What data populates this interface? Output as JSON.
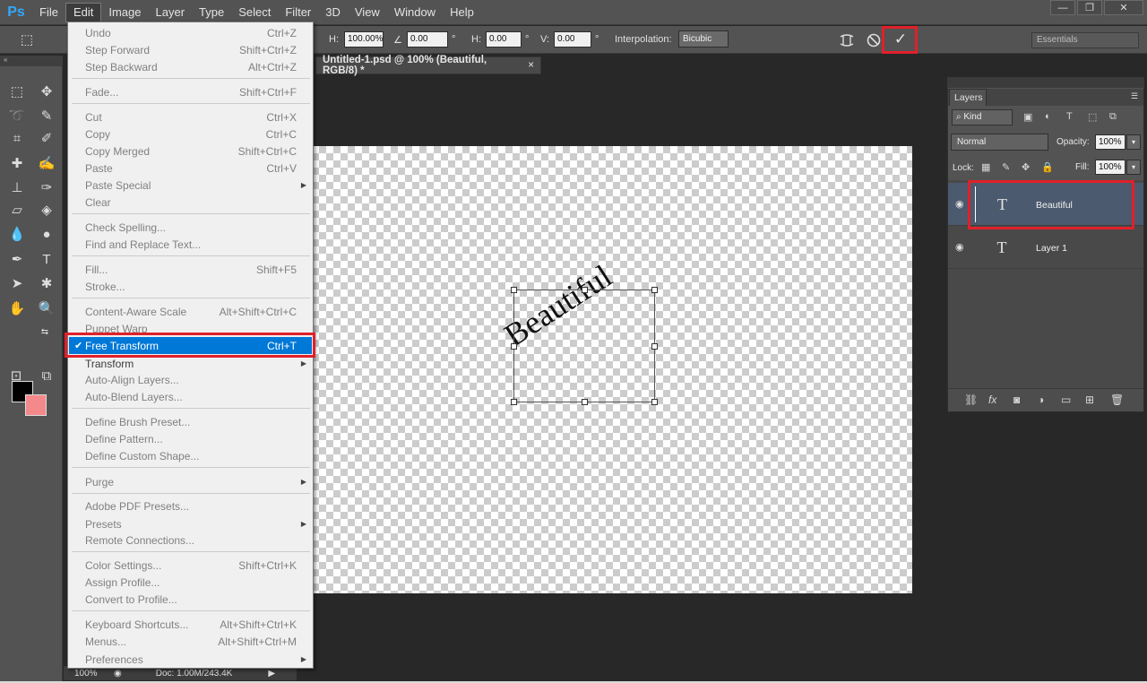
{
  "app": {
    "logo": "Ps"
  },
  "menubar": {
    "items": [
      "File",
      "Edit",
      "Image",
      "Layer",
      "Type",
      "Select",
      "Filter",
      "3D",
      "View",
      "Window",
      "Help"
    ]
  },
  "window_controls": {
    "minimize": "—",
    "restore": "❐",
    "close": "✕"
  },
  "options_bar": {
    "h_label": "H:",
    "h_value": "100.00%",
    "angle_value": "0.00",
    "angle_unit": "°",
    "hskew_label": "H:",
    "hskew_value": "0.00",
    "hskew_unit": "°",
    "vskew_label": "V:",
    "vskew_value": "0.00",
    "vskew_unit": "°",
    "interpolation_label": "Interpolation:",
    "interpolation_value": "Bicubic",
    "commit_symbol": "✓",
    "workspace": "Essentials"
  },
  "document": {
    "tab_title": "Untitled-1.psd @ 100% (Beautiful, RGB/8) *",
    "tab_close": "×",
    "canvas_text": "Beautiful"
  },
  "statusbar": {
    "zoom": "100%",
    "doc_info": "Doc: 1.00M/243.4K"
  },
  "edit_menu": {
    "items": [
      {
        "label": "Undo",
        "shortcut": "Ctrl+Z"
      },
      {
        "label": "Step Forward",
        "shortcut": "Shift+Ctrl+Z"
      },
      {
        "label": "Step Backward",
        "shortcut": "Alt+Ctrl+Z"
      },
      {
        "label": "Fade...",
        "shortcut": "Shift+Ctrl+F"
      },
      {
        "label": "Cut",
        "shortcut": "Ctrl+X"
      },
      {
        "label": "Copy",
        "shortcut": "Ctrl+C"
      },
      {
        "label": "Copy Merged",
        "shortcut": "Shift+Ctrl+C"
      },
      {
        "label": "Paste",
        "shortcut": "Ctrl+V"
      },
      {
        "label": "Paste Special",
        "shortcut": ""
      },
      {
        "label": "Clear",
        "shortcut": ""
      },
      {
        "label": "Check Spelling...",
        "shortcut": ""
      },
      {
        "label": "Find and Replace Text...",
        "shortcut": ""
      },
      {
        "label": "Fill...",
        "shortcut": "Shift+F5"
      },
      {
        "label": "Stroke...",
        "shortcut": ""
      },
      {
        "label": "Content-Aware Scale",
        "shortcut": "Alt+Shift+Ctrl+C"
      },
      {
        "label": "Puppet Warp",
        "shortcut": ""
      },
      {
        "label": "Free Transform",
        "shortcut": "Ctrl+T"
      },
      {
        "label": "Transform",
        "shortcut": ""
      },
      {
        "label": "Auto-Align Layers...",
        "shortcut": ""
      },
      {
        "label": "Auto-Blend Layers...",
        "shortcut": ""
      },
      {
        "label": "Define Brush Preset...",
        "shortcut": ""
      },
      {
        "label": "Define Pattern...",
        "shortcut": ""
      },
      {
        "label": "Define Custom Shape...",
        "shortcut": ""
      },
      {
        "label": "Purge",
        "shortcut": ""
      },
      {
        "label": "Adobe PDF Presets...",
        "shortcut": ""
      },
      {
        "label": "Presets",
        "shortcut": ""
      },
      {
        "label": "Remote Connections...",
        "shortcut": ""
      },
      {
        "label": "Color Settings...",
        "shortcut": "Shift+Ctrl+K"
      },
      {
        "label": "Assign Profile...",
        "shortcut": ""
      },
      {
        "label": "Convert to Profile...",
        "shortcut": ""
      },
      {
        "label": "Keyboard Shortcuts...",
        "shortcut": "Alt+Shift+Ctrl+K"
      },
      {
        "label": "Menus...",
        "shortcut": "Alt+Shift+Ctrl+M"
      },
      {
        "label": "Preferences",
        "shortcut": ""
      }
    ],
    "checkmark": "✔"
  },
  "layers_panel": {
    "tab": "Layers",
    "filter_kind": "Kind",
    "blend_mode": "Normal",
    "opacity_label": "Opacity:",
    "opacity_value": "100%",
    "lock_label": "Lock:",
    "fill_label": "Fill:",
    "fill_value": "100%",
    "layers": [
      {
        "name": "Beautiful",
        "type_glyph": "T"
      },
      {
        "name": "Layer 1",
        "type_glyph": "T"
      }
    ]
  },
  "colors": {
    "foreground": "#000000",
    "background": "#f4898b",
    "accent": "#0078d7",
    "highlight": "#e0202a"
  }
}
